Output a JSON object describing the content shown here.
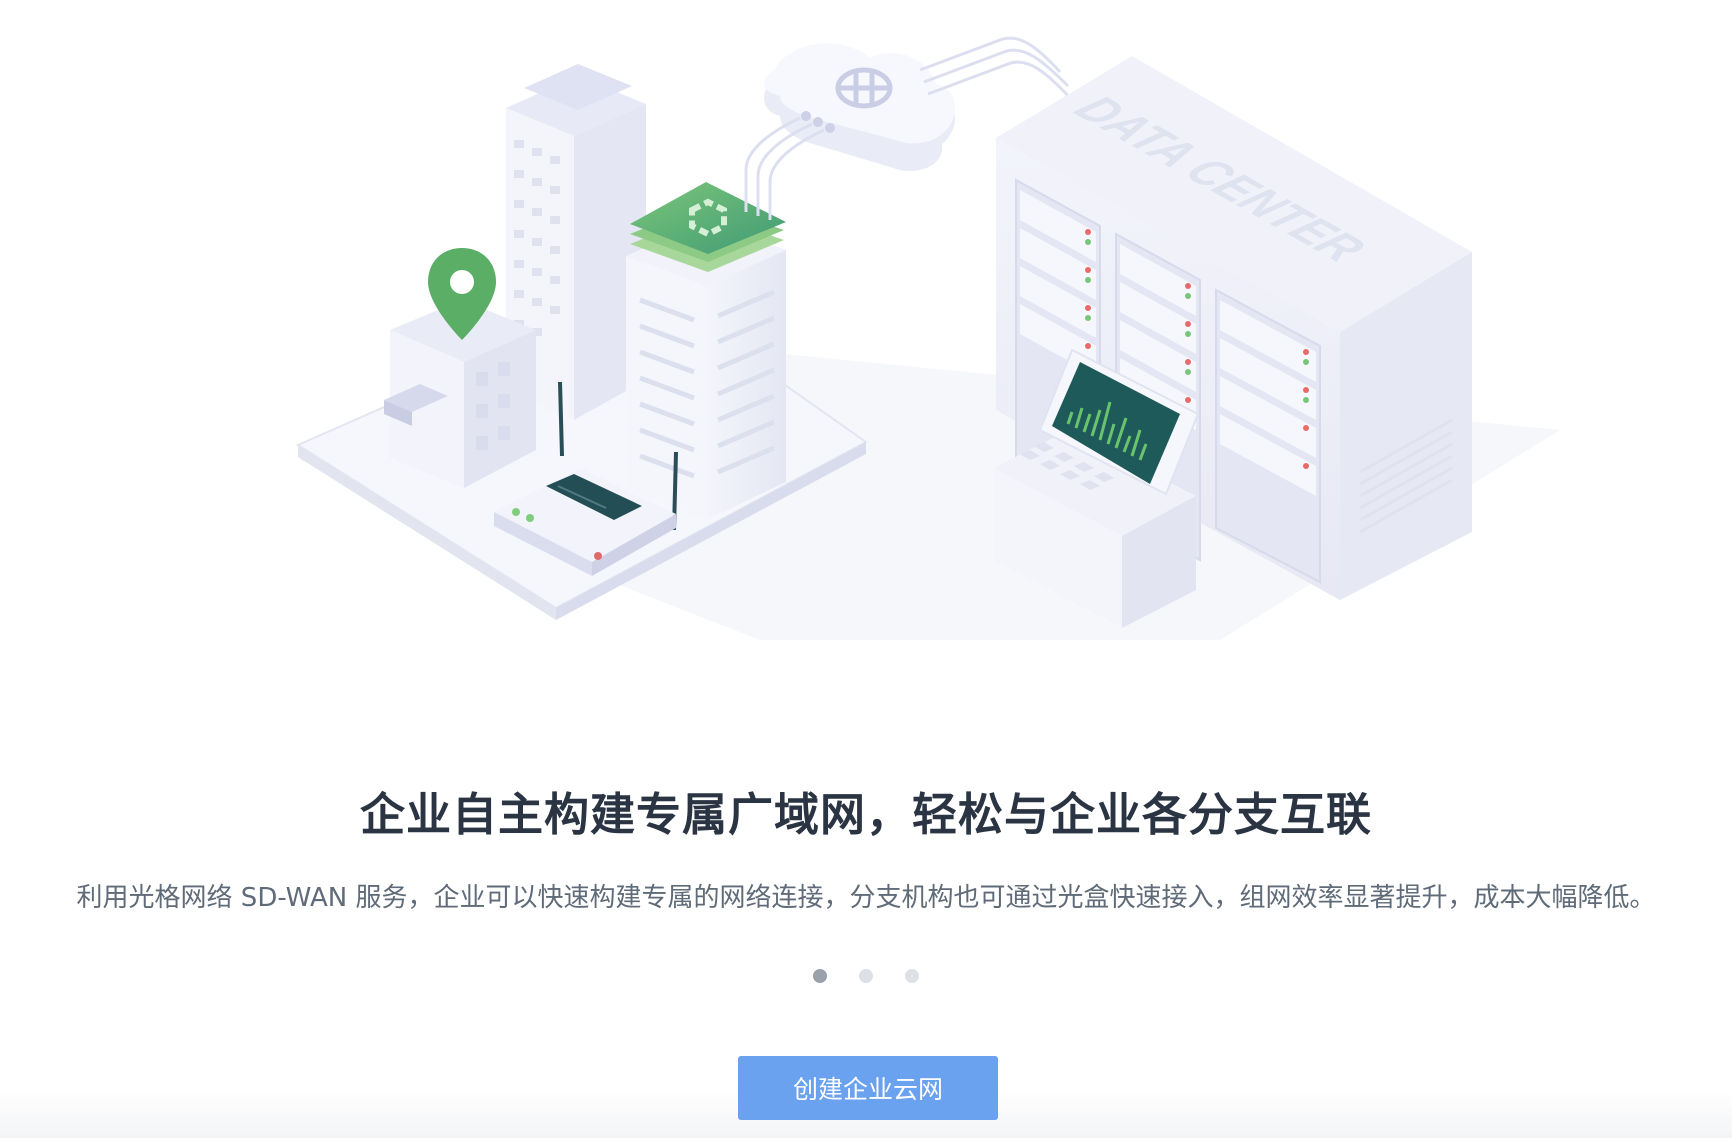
{
  "illustration": {
    "data_center_label": "DATA CENTER"
  },
  "headline": "企业自主构建专属广域网，轻松与企业各分支互联",
  "subline": "利用光格网络 SD-WAN 服务，企业可以快速构建专属的网络连接，分支机构也可通过光盒快速接入，组网效率显著提升，成本大幅降低。",
  "carousel": {
    "slides": 3,
    "active_index": 0
  },
  "cta": {
    "label": "创建企业云网"
  },
  "colors": {
    "accent_green": "#5db36e",
    "button_blue": "#6aa2f0",
    "screen_dark": "#1f5a5a"
  }
}
